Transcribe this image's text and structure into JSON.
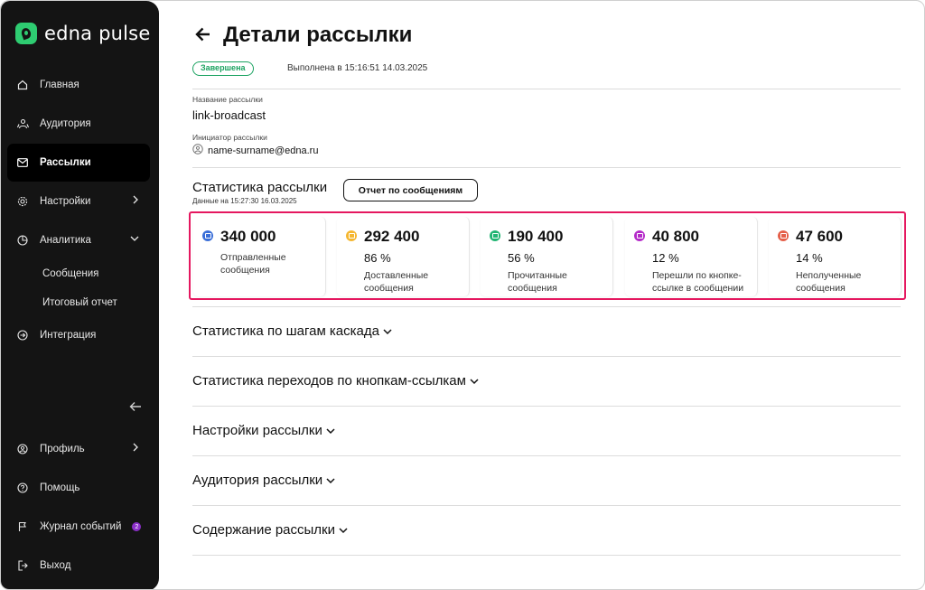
{
  "brand": {
    "name": "edna pulse",
    "accent": "#2ecc71"
  },
  "sidebar": {
    "items": [
      {
        "label": "Главная",
        "icon": "home-icon"
      },
      {
        "label": "Аудитория",
        "icon": "audience-icon"
      },
      {
        "label": "Рассылки",
        "icon": "mail-icon",
        "active": true
      },
      {
        "label": "Настройки",
        "icon": "gear-icon"
      },
      {
        "label": "Аналитика",
        "icon": "chart-pie-icon"
      },
      {
        "label": "Интеграция",
        "icon": "integration-icon"
      }
    ],
    "sub_items": [
      "Сообщения",
      "Итоговый отчет"
    ],
    "bottom": [
      {
        "label": "Профиль",
        "icon": "user-icon"
      },
      {
        "label": "Помощь",
        "icon": "help-icon"
      },
      {
        "label": "Журнал событий",
        "icon": "flag-icon",
        "badge": "2"
      },
      {
        "label": "Выход",
        "icon": "logout-icon"
      }
    ]
  },
  "header": {
    "title": "Детали рассылки",
    "status": "Завершена",
    "executed": "Выполнена в 15:16:51 14.03.2025"
  },
  "details": {
    "name_label": "Название рассылки",
    "name_value": "link-broadcast",
    "initiator_label": "Инициатор рассылки",
    "initiator_value": "name-surname@edna.ru"
  },
  "stats": {
    "title": "Статистика рассылки",
    "subtitle": "Данные на 15:27:30 16.03.2025",
    "report_button": "Отчет по сообщениям",
    "cards": [
      {
        "value": "340 000",
        "percent": "",
        "label": "Отправленные сообщения",
        "color": "#3b6fd8"
      },
      {
        "value": "292 400",
        "percent": "86 %",
        "label": "Доставленные сообщения",
        "color": "#f5b731"
      },
      {
        "value": "190 400",
        "percent": "56 %",
        "label": "Прочитанные сообщения",
        "color": "#22b573"
      },
      {
        "value": "40 800",
        "percent": "12 %",
        "label": "Перешли по кнопке-ссылке в сообщении",
        "color": "#b52bc9"
      },
      {
        "value": "47 600",
        "percent": "14 %",
        "label": "Неполученные сообщения",
        "color": "#e5604a"
      }
    ]
  },
  "sections": [
    "Статистика по шагам каскада",
    "Статистика переходов по кнопкам-ссылкам",
    "Настройки рассылки",
    "Аудитория рассылки",
    "Содержание рассылки"
  ]
}
